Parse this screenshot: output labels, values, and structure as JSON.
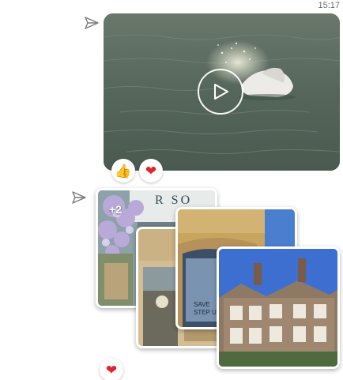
{
  "conversation": {
    "timestamp": "15:17",
    "messages": [
      {
        "type": "video",
        "status_icon": "sent-icon",
        "play_icon": "play-icon",
        "reactions": [
          {
            "icon": "thumbs-up-icon",
            "glyph": "👍"
          },
          {
            "icon": "heart-icon",
            "glyph": "❤"
          }
        ]
      },
      {
        "type": "photo-album",
        "status_icon": "sent-icon",
        "more_photos_count": "+2",
        "photo_signs": {
          "sign_1": "R SO",
          "sign_2": "SAVE",
          "sign_3": "STEP UP"
        },
        "reactions": [
          {
            "icon": "heart-icon",
            "glyph": "❤"
          }
        ]
      }
    ]
  },
  "colors": {
    "sent_icon": "#7a7a7a",
    "heart": "#e0242f",
    "thumbs_up": "#f5b92e",
    "timestamp": "#6b6b6b"
  }
}
